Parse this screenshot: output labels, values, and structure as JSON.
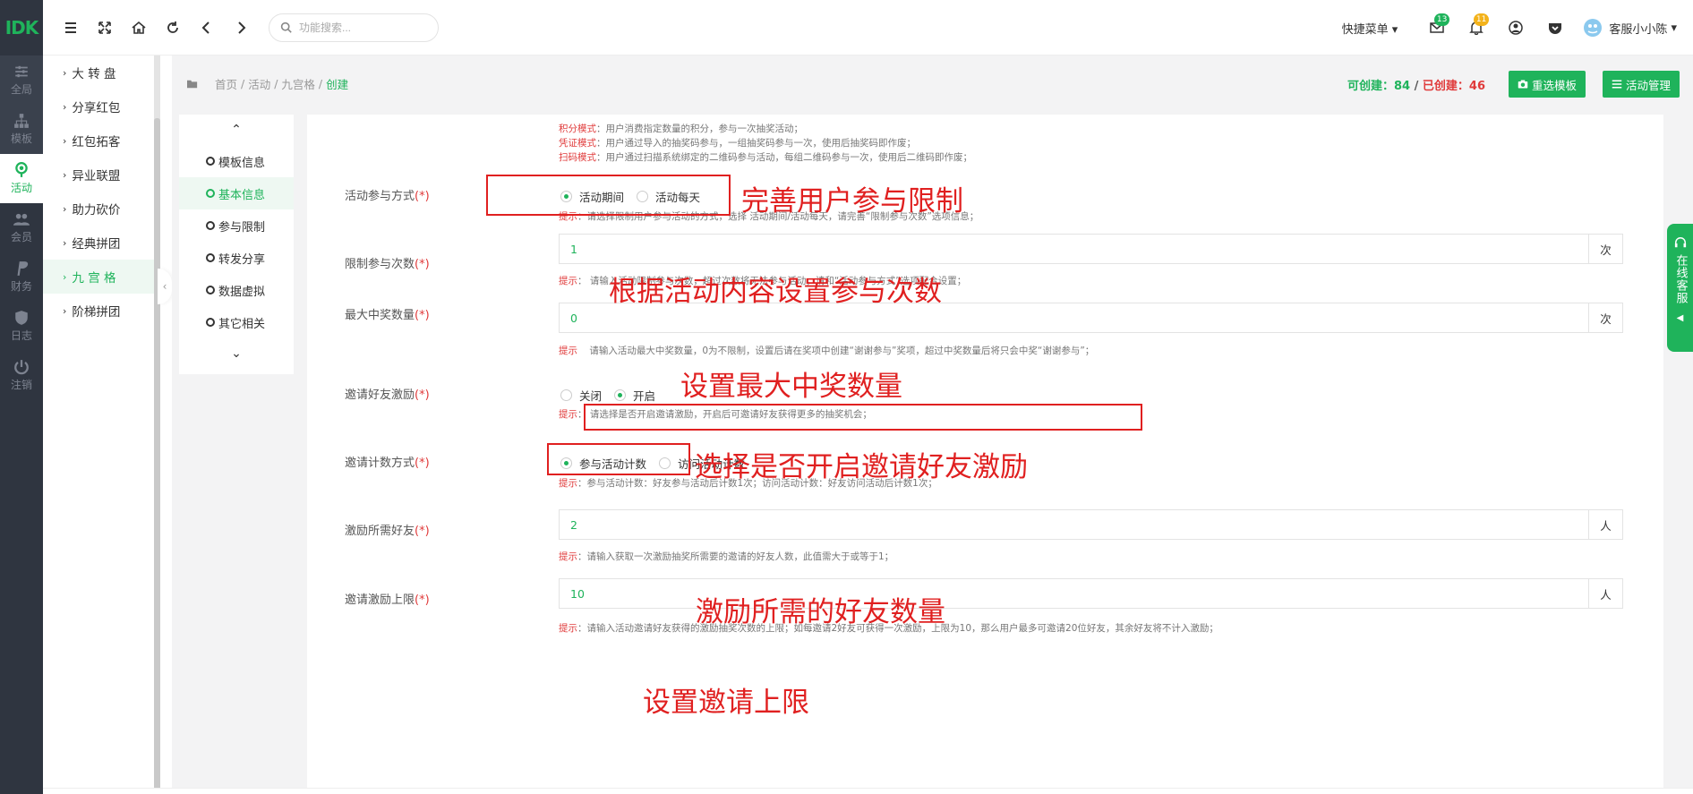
{
  "brand": {
    "logo_text": "IDK",
    "accent": "#1fb35b",
    "danger": "#e03a3a"
  },
  "rail": [
    {
      "label": "全局",
      "icon": "sliders-icon"
    },
    {
      "label": "模板",
      "icon": "sitemap-icon"
    },
    {
      "label": "活动",
      "icon": "location-icon",
      "active": true
    },
    {
      "label": "会员",
      "icon": "users-icon"
    },
    {
      "label": "财务",
      "icon": "paypal-icon"
    },
    {
      "label": "日志",
      "icon": "shield-icon"
    },
    {
      "label": "注销",
      "icon": "power-icon"
    }
  ],
  "submenu": [
    {
      "label": "大 转 盘"
    },
    {
      "label": "分享红包"
    },
    {
      "label": "红包拓客"
    },
    {
      "label": "异业联盟"
    },
    {
      "label": "助力砍价"
    },
    {
      "label": "经典拼团"
    },
    {
      "label": "九 宫 格",
      "active": true
    },
    {
      "label": "阶梯拼团"
    }
  ],
  "topbar": {
    "search_placeholder": "功能搜索...",
    "quick_menu": "快捷菜单",
    "mail_badge": "13",
    "bell_badge": "11",
    "user_name": "客服小小陈"
  },
  "breadcrumb": {
    "home": "首页",
    "sep": "/",
    "level1": "活动",
    "level2": "九宫格",
    "current": "创建"
  },
  "counts": {
    "can_create_label": "可创建：",
    "can_create": "84",
    "sep": " / ",
    "created_label": "已创建：",
    "created": "46"
  },
  "buttons": {
    "reselect": "重选模板",
    "manage": "活动管理"
  },
  "steps": {
    "items": [
      "模板信息",
      "基本信息",
      "参与限制",
      "转发分享",
      "数据虚拟",
      "其它相关"
    ],
    "active_index": 1
  },
  "mode_notes": [
    {
      "key": "积分模式",
      "text": "：用户消费指定数量的积分，参与一次抽奖活动；"
    },
    {
      "key": "凭证模式",
      "text": "：用户通过导入的抽奖码参与，一组抽奖码参与一次，使用后抽奖码即作废；"
    },
    {
      "key": "扫码模式",
      "text": "：用户通过扫描系统绑定的二维码参与活动，每组二维码参与一次，使用后二维码即作废；"
    }
  ],
  "form": {
    "participation": {
      "label": "活动参与方式",
      "req": "(*)",
      "options": [
        "活动期间",
        "活动每天"
      ],
      "selected": 0,
      "tip_key": "提示",
      "tip": "：请选择限制用户参与活动的方式，选择 活动期间/活动每天，请完善“限制参与次数”选项信息；"
    },
    "limit_times": {
      "label": "限制参与次数",
      "req": "(*)",
      "value": "1",
      "unit": "次",
      "tip_key": "提示",
      "tip": "： 请输入活动限制参与次数，超过次数将无法参与活动，请和“活动参与方式”选项配合设置；"
    },
    "max_prize": {
      "label": "最大中奖数量",
      "req": "(*)",
      "value": "0",
      "unit": "次",
      "tip_key": "提示",
      "tip": "请输入活动最大中奖数量，0为不限制，设置后请在奖项中创建“谢谢参与”奖项，超过中奖数量后将只会中奖“谢谢参与”；"
    },
    "invite": {
      "label": "邀请好友激励",
      "req": "(*)",
      "options": [
        "关闭",
        "开启"
      ],
      "selected": 1,
      "tip_key": "提示",
      "tip": "： 请选择是否开启邀请激励，开启后可邀请好友获得更多的抽奖机会；"
    },
    "count_mode": {
      "label": "邀请计数方式",
      "req": "(*)",
      "options": [
        "参与活动计数",
        "访问活动计数"
      ],
      "selected": 0,
      "tip_key": "提示",
      "tip": "：参与活动计数：好友参与活动后计数1次；访问活动计数：好友访问活动后计数1次；"
    },
    "friends_needed": {
      "label": "激励所需好友",
      "req": "(*)",
      "value": "2",
      "unit": "人",
      "tip_key": "提示",
      "tip": "：请输入获取一次激励抽奖所需要的邀请的好友人数，此值需大于或等于1；"
    },
    "invite_limit": {
      "label": "邀请激励上限",
      "req": "(*)",
      "value": "10",
      "unit": "人",
      "tip_key": "提示",
      "tip": "：请输入活动邀请好友获得的激励抽奖次数的上限；如每邀请2好友可获得一次激励，上限为10，那么用户最多可邀请20位好友，其余好友将不计入激励；"
    }
  },
  "annotations": {
    "a1": "完善用户参与限制",
    "a2": "根据活动内容设置参与次数",
    "a3": "设置最大中奖数量",
    "a4": "选择是否开启邀请好友激励",
    "a5": "激励所需的好友数量",
    "a6": "设置邀请上限"
  },
  "service_tab": "在线客服"
}
